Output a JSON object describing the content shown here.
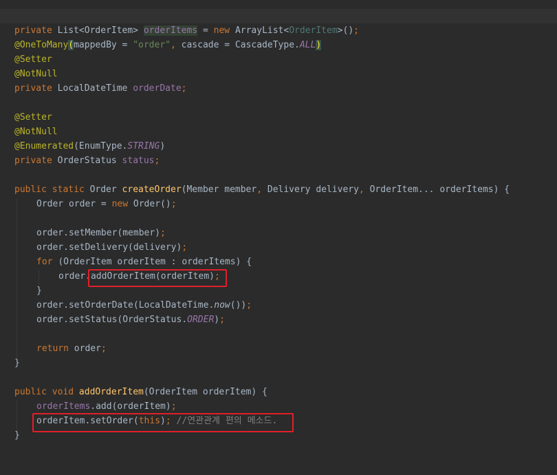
{
  "code": {
    "l1": {
      "at_onetomany": "@OneToMany",
      "p_open": "(",
      "mapped_by": "mappedBy = ",
      "order_str": "\"order\"",
      "comma": ", ",
      "cascade": "cascade = CascadeType.",
      "all": "ALL",
      "p_close": ")"
    },
    "l2": {
      "private": "private ",
      "list_type": "List<OrderItem> ",
      "order_items": "orderItems",
      "eq": " = ",
      "new": "new ",
      "arraylist": "ArrayList<",
      "generic": "OrderItem",
      "close": ">()",
      "semi": ";"
    },
    "l4": {
      "setter": "@Setter"
    },
    "l5": {
      "notnull": "@NotNull"
    },
    "l6": {
      "private": "private ",
      "type": "LocalDateTime ",
      "field": "orderDate",
      "semi": ";"
    },
    "l8": {
      "setter": "@Setter"
    },
    "l9": {
      "notnull": "@NotNull"
    },
    "l10": {
      "enumerated": "@Enumerated",
      "open": "(EnumType.",
      "string": "STRING",
      "close": ")"
    },
    "l11": {
      "private": "private ",
      "type": "OrderStatus ",
      "field": "status",
      "semi": ";"
    },
    "l13": {
      "public_static": "public static ",
      "ret": "Order ",
      "name": "createOrder",
      "p1": "(Member member",
      "c1": ", ",
      "p2": "Delivery delivery",
      "c2": ", ",
      "p3": "OrderItem... orderItems) {"
    },
    "l14": {
      "decl": "Order order = ",
      "new": "new ",
      "ctor": "Order()",
      "semi": ";"
    },
    "l16": {
      "call": "order.setMember(member)",
      "semi": ";"
    },
    "l17": {
      "call": "order.setDelivery(delivery)",
      "semi": ";"
    },
    "l18": {
      "for": "for ",
      "rest": "(OrderItem orderItem : orderItems) {"
    },
    "l19": {
      "order": "order",
      "dot": ".",
      "call": "addOrderItem(orderItem)",
      "semi": ";"
    },
    "l20": {
      "brace": "}"
    },
    "l21": {
      "call": "order.setOrderDate(LocalDateTime.",
      "now": "now",
      "close": "())",
      "semi": ";"
    },
    "l22": {
      "call": "order.setStatus(OrderStatus.",
      "order_const": "ORDER",
      "close": ")",
      "semi": ";"
    },
    "l24": {
      "return": "return ",
      "value": "order",
      "semi": ";"
    },
    "l25": {
      "brace": "}"
    },
    "l27": {
      "public_void": "public void ",
      "name": "addOrderItem",
      "params": "(OrderItem orderItem) {"
    },
    "l28": {
      "field": "orderItems",
      "call": ".add(orderItem)",
      "semi": ";"
    },
    "l29": {
      "call": "orderItem.setOrder(",
      "this": "this",
      "close": ")",
      "semi": "; ",
      "comment": "//연관관계 편의 메소드."
    },
    "l30": {
      "brace": "}"
    }
  },
  "colors": {
    "background": "#2b2b2b",
    "current_line": "#323232",
    "keyword": "#cc7832",
    "annotation": "#bbb529",
    "string": "#6a8759",
    "field": "#9876aa",
    "method_decl": "#ffc66d",
    "comment": "#808080",
    "highlight_box": "#e0202a"
  }
}
